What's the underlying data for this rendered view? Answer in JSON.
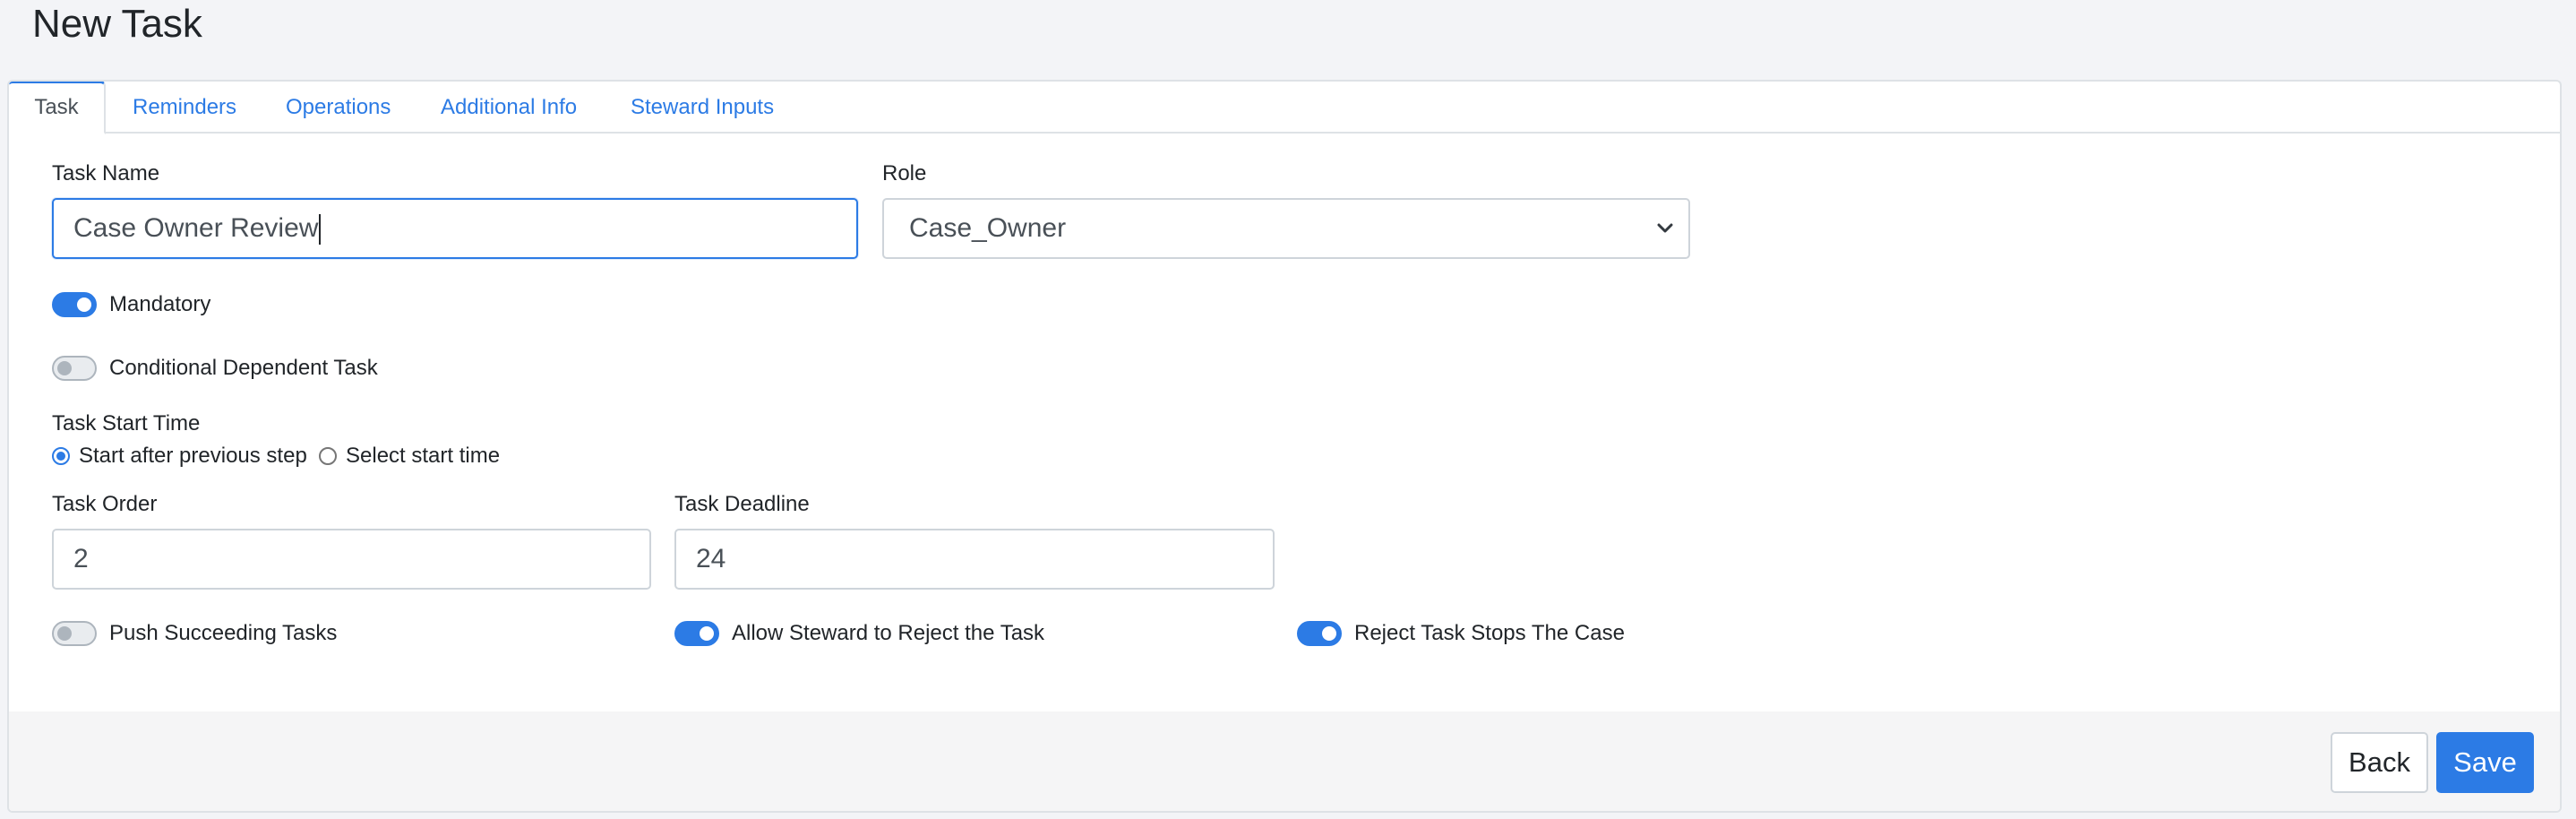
{
  "page": {
    "title": "New Task"
  },
  "tabs": [
    {
      "label": "Task",
      "active": true
    },
    {
      "label": "Reminders",
      "active": false
    },
    {
      "label": "Operations",
      "active": false
    },
    {
      "label": "Additional Info",
      "active": false
    },
    {
      "label": "Steward Inputs",
      "active": false
    }
  ],
  "form": {
    "task_name": {
      "label": "Task Name",
      "value": "Case Owner Review"
    },
    "role": {
      "label": "Role",
      "value": "Case_Owner"
    },
    "mandatory": {
      "label": "Mandatory",
      "checked": true
    },
    "conditional_dependent_task": {
      "label": "Conditional Dependent Task",
      "checked": false
    },
    "task_start_time": {
      "label": "Task Start Time",
      "options": [
        {
          "label": "Start after previous step",
          "checked": true
        },
        {
          "label": "Select start time",
          "checked": false
        }
      ]
    },
    "task_order": {
      "label": "Task Order",
      "value": "2"
    },
    "task_deadline": {
      "label": "Task Deadline",
      "value": "24"
    },
    "push_succeeding_tasks": {
      "label": "Push Succeeding Tasks",
      "checked": false
    },
    "allow_steward_reject": {
      "label": "Allow Steward to Reject the Task",
      "checked": true
    },
    "reject_stops_case": {
      "label": "Reject Task Stops The Case",
      "checked": true
    }
  },
  "footer": {
    "back_label": "Back",
    "save_label": "Save"
  },
  "colors": {
    "accent": "#2c7be5",
    "border": "#ced4da",
    "background": "#f3f4f7"
  }
}
